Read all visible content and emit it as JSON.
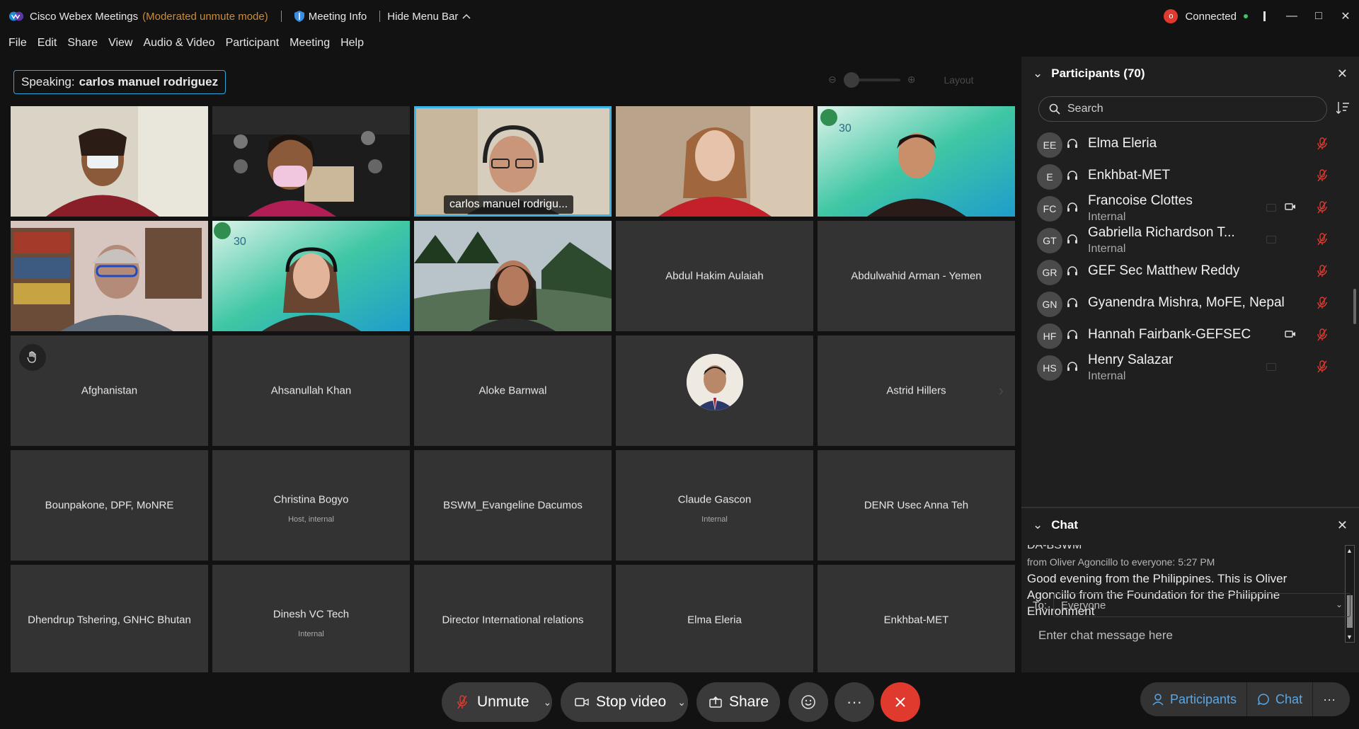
{
  "titlebar": {
    "app_name": "Cisco Webex Meetings",
    "mode": "(Moderated unmute mode)",
    "meeting_info": "Meeting Info",
    "hide_menu": "Hide Menu Bar",
    "connection_badge": "o",
    "connection_status": "Connected"
  },
  "menu": {
    "file": "File",
    "edit": "Edit",
    "share": "Share",
    "view": "View",
    "audio_video": "Audio & Video",
    "participant": "Participant",
    "meeting": "Meeting",
    "help": "Help"
  },
  "speaking": {
    "label": "Speaking:",
    "name": "carlos manuel rodriguez"
  },
  "layout_label": "Layout",
  "tiles": [
    {
      "name": "",
      "sub": "",
      "video": true
    },
    {
      "name": "",
      "sub": "",
      "video": true
    },
    {
      "name": "carlos manuel rodrigu...",
      "sub": "",
      "video": true,
      "active": true
    },
    {
      "name": "",
      "sub": "",
      "video": true
    },
    {
      "name": "",
      "sub": "",
      "video": true
    },
    {
      "name": "",
      "sub": "",
      "video": true
    },
    {
      "name": "",
      "sub": "",
      "video": true
    },
    {
      "name": "",
      "sub": "",
      "video": true
    },
    {
      "name": "Abdul Hakim Aulaiah",
      "sub": ""
    },
    {
      "name": "Abdulwahid Arman - Yemen",
      "sub": ""
    },
    {
      "name": "Afghanistan",
      "sub": ""
    },
    {
      "name": "Ahsanullah Khan",
      "sub": ""
    },
    {
      "name": "Aloke Barnwal",
      "sub": ""
    },
    {
      "name": "",
      "sub": ""
    },
    {
      "name": "Astrid Hillers",
      "sub": ""
    },
    {
      "name": "Bounpakone, DPF, MoNRE",
      "sub": ""
    },
    {
      "name": "Christina Bogyo",
      "sub": "Host, internal"
    },
    {
      "name": "BSWM_Evangeline Dacumos",
      "sub": ""
    },
    {
      "name": "Claude Gascon",
      "sub": "Internal"
    },
    {
      "name": "DENR Usec Anna Teh",
      "sub": ""
    },
    {
      "name": "Dhendrup Tshering, GNHC Bhutan",
      "sub": ""
    },
    {
      "name": "Dinesh VC Tech",
      "sub": "Internal"
    },
    {
      "name": "Director International relations",
      "sub": ""
    },
    {
      "name": "Elma Eleria",
      "sub": ""
    },
    {
      "name": "Enkhbat-MET",
      "sub": ""
    }
  ],
  "participants": {
    "title": "Participants (70)",
    "search_placeholder": "Search",
    "list": [
      {
        "initials": "EE",
        "name": "Elma Eleria",
        "sub": ""
      },
      {
        "initials": "E",
        "name": "Enkhbat-MET",
        "sub": ""
      },
      {
        "initials": "FC",
        "name": "Francoise Clottes",
        "sub": "Internal",
        "video": true
      },
      {
        "initials": "GT",
        "name": "Gabriella Richardson T...",
        "sub": "Internal"
      },
      {
        "initials": "GR",
        "name": "GEF Sec Matthew Reddy",
        "sub": ""
      },
      {
        "initials": "GN",
        "name": "Gyanendra Mishra, MoFE, Nepal",
        "sub": ""
      },
      {
        "initials": "HF",
        "name": "Hannah Fairbank-GEFSEC",
        "sub": "",
        "video": true
      },
      {
        "initials": "HS",
        "name": "Henry Salazar",
        "sub": "Internal"
      }
    ]
  },
  "chat": {
    "title": "Chat",
    "prev_line": "DA-BSWM",
    "meta": "from Oliver Agoncillo to everyone:    5:27 PM",
    "message": "Good evening from the Philippines. This is Oliver Agoncillo from the Foundation for the Philippine Environment",
    "to_label": "To:",
    "to_value": "Everyone",
    "input_placeholder": "Enter chat message here"
  },
  "controls": {
    "unmute": "Unmute",
    "stop_video": "Stop video",
    "share": "Share",
    "more": "···",
    "participants": "Participants",
    "chat": "Chat"
  },
  "colors": {
    "accent": "#3cb4e6",
    "leave": "#e0392e",
    "mode_text": "#c98b3c",
    "mic_muted": "#e0392e",
    "link_blue": "#5aa7e6"
  }
}
